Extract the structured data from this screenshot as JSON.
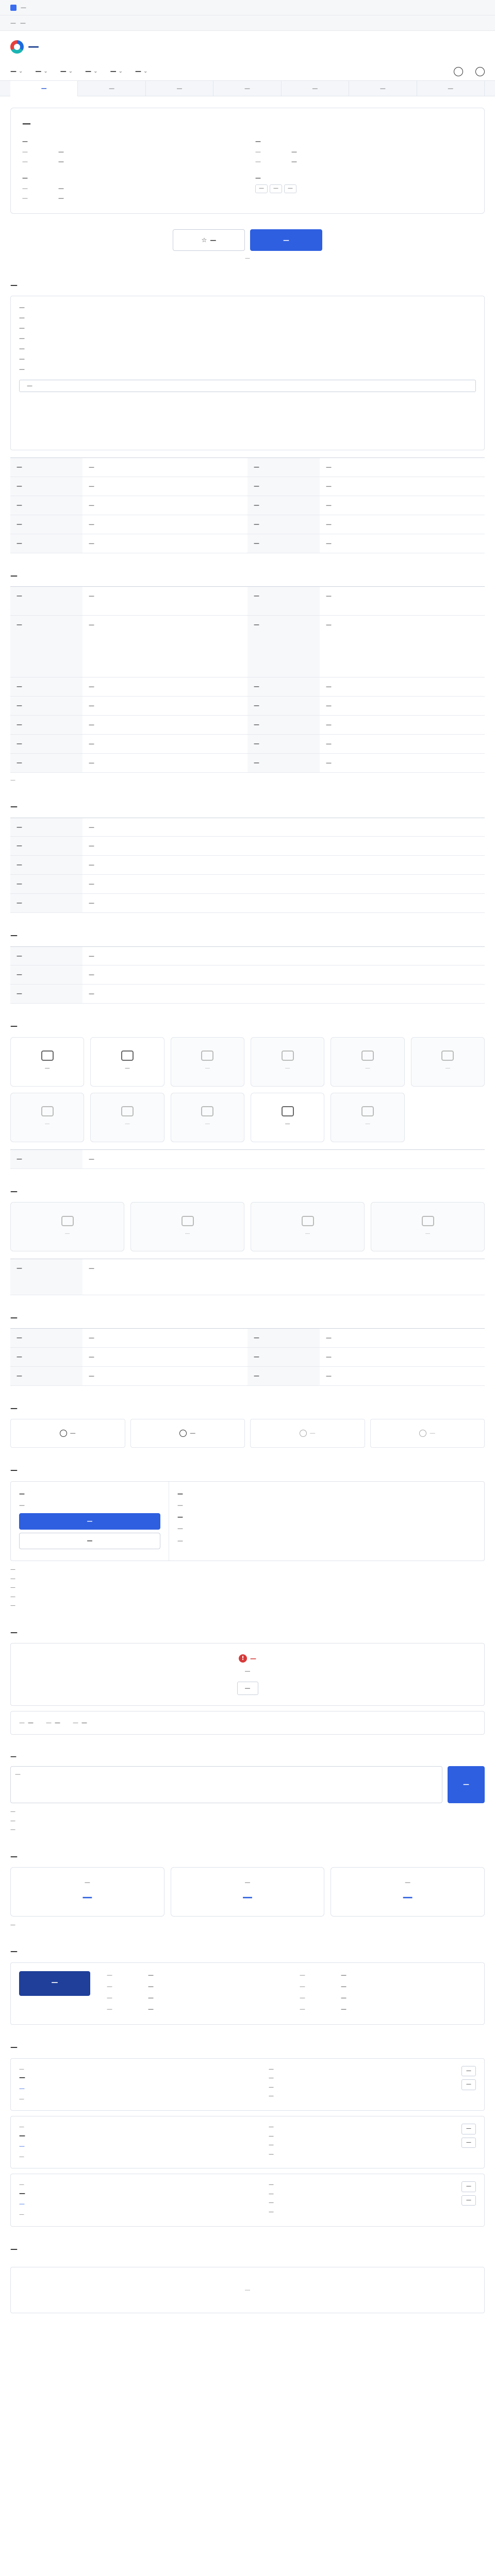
{
  "notice": {
    "text": "—",
    "links": [
      "—",
      "—"
    ]
  },
  "brand": {
    "name": "—",
    "accent": "#2e5fe0"
  },
  "nav": {
    "items": [
      "—",
      "—",
      "—",
      "—",
      "—",
      "—"
    ]
  },
  "tabs": [
    "—",
    "—",
    "—",
    "—",
    "—",
    "—",
    "—"
  ],
  "job": {
    "title": "—",
    "left": {
      "label": "—",
      "rows": [
        {
          "k": "—",
          "v": "—"
        },
        {
          "k": "—",
          "v": "—"
        }
      ]
    },
    "right": {
      "label": "—",
      "rows": [
        {
          "k": "—",
          "v": "—"
        },
        {
          "k": "—",
          "v": "—"
        }
      ]
    },
    "left2": {
      "label": "—",
      "rows": [
        {
          "k": "—",
          "v": "—"
        },
        {
          "k": "—",
          "v": "—"
        }
      ]
    },
    "right2": {
      "label": "—",
      "chips": [
        "—",
        "—",
        "—"
      ]
    }
  },
  "actions": {
    "bookmark": "—",
    "apply": "—",
    "note": "—"
  },
  "sections": {
    "recruit": {
      "title": "—",
      "lines": [
        "—",
        "—",
        "—",
        "—",
        "—",
        "—",
        "—"
      ],
      "more": "—",
      "rows": [
        {
          "k": "—",
          "v": "—",
          "k2": "—",
          "v2": "—"
        },
        {
          "k": "—",
          "v": "—",
          "k2": "—",
          "v2": "—"
        },
        {
          "k": "—",
          "v": "—",
          "k2": "—",
          "v2": "—"
        },
        {
          "k": "—",
          "v": "—",
          "k2": "—",
          "v2": "—"
        },
        {
          "k": "—",
          "v": "—",
          "k2": "—",
          "v2": "—"
        }
      ]
    },
    "conditions": {
      "title": "—",
      "rows": [
        {
          "k": "—",
          "v": "—",
          "k2": "—",
          "v2": "—"
        },
        {
          "k": "—",
          "v": "—",
          "k2": "—",
          "v2": "—"
        },
        {
          "k": "—",
          "v": "—",
          "k2": "—",
          "v2": "—"
        },
        {
          "k": "—",
          "v": "—",
          "k2": "—",
          "v2": "—"
        },
        {
          "k": "—",
          "v": "—",
          "k2": "—",
          "v2": "—"
        },
        {
          "k": "—",
          "v": "—",
          "k2": "—",
          "v2": "—"
        },
        {
          "k": "—",
          "v": "—",
          "k2": "—",
          "v2": "—"
        }
      ],
      "note": "—"
    },
    "qualify": {
      "title": "—",
      "rows": [
        {
          "k": "—",
          "v": "—"
        },
        {
          "k": "—",
          "v": "—"
        },
        {
          "k": "—",
          "v": "—"
        },
        {
          "k": "—",
          "v": "—"
        },
        {
          "k": "—",
          "v": "—"
        }
      ]
    },
    "other": {
      "title": "—",
      "rows": [
        {
          "k": "—",
          "v": "—"
        },
        {
          "k": "—",
          "v": "—"
        },
        {
          "k": "—",
          "v": "—"
        }
      ]
    },
    "welfare": {
      "title": "—",
      "items": [
        "—",
        "—",
        "—",
        "—",
        "—",
        "—",
        "—",
        "—",
        "—",
        "—",
        "—"
      ],
      "rowk": "—",
      "rowv": "—"
    },
    "disability": {
      "title": "—",
      "items": [
        "—",
        "—",
        "—",
        "—"
      ],
      "rowk": "—",
      "rowv": "—"
    },
    "workplace": {
      "title": "—",
      "rows": [
        {
          "k": "—",
          "v": "—",
          "k2": "—",
          "v2": "—"
        },
        {
          "k": "—",
          "v": "—",
          "k2": "—",
          "v2": "—"
        },
        {
          "k": "—",
          "v": "—",
          "k2": "—",
          "v2": "—"
        }
      ]
    },
    "process": {
      "title": "—",
      "steps": [
        "—",
        "—",
        "—",
        "—"
      ]
    },
    "apply": {
      "title": "—",
      "left": {
        "lab": "—",
        "v": "—",
        "b1": "—",
        "b2": "—"
      },
      "right": {
        "lab": "—",
        "v": "—",
        "lab2": "—",
        "v2": "—",
        "v3": "—"
      },
      "notes": [
        "—",
        "—",
        "—",
        "—",
        "—"
      ]
    },
    "contact": {
      "title": "—",
      "warn": "—",
      "warn_text": "—",
      "warn_btn": "—",
      "row": [
        {
          "k": "—",
          "v": "—"
        },
        {
          "k": "—",
          "v": "—"
        },
        {
          "k": "—",
          "v": "—"
        }
      ]
    },
    "inquiry": {
      "title": "—",
      "placeholder": "—",
      "send": "—",
      "bullets": [
        "—",
        "—",
        "—"
      ]
    },
    "stats": {
      "title": "—",
      "items": [
        {
          "k": "—",
          "v": "—"
        },
        {
          "k": "—",
          "v": "—"
        },
        {
          "k": "—",
          "v": "—"
        }
      ],
      "note": "—"
    },
    "company": {
      "title": "—",
      "logo": "—",
      "rows": [
        {
          "k": "—",
          "v": "—"
        },
        {
          "k": "—",
          "v": "—"
        },
        {
          "k": "—",
          "v": "—"
        },
        {
          "k": "—",
          "v": "—"
        }
      ],
      "rows2": [
        {
          "k": "—",
          "v": "—"
        },
        {
          "k": "—",
          "v": "—"
        },
        {
          "k": "—",
          "v": "—"
        },
        {
          "k": "—",
          "v": "—"
        }
      ]
    },
    "similar": {
      "title": "—",
      "jobs": [
        {
          "badge": "—",
          "t": "—",
          "co": "—",
          "sub": "—",
          "meta": [
            "—",
            "—",
            "—",
            "—"
          ],
          "cta": [
            "—",
            "—"
          ]
        },
        {
          "badge": "—",
          "t": "—",
          "co": "—",
          "sub": "—",
          "meta": [
            "—",
            "—",
            "—",
            "—"
          ],
          "cta": [
            "—",
            "—"
          ]
        },
        {
          "badge": "—",
          "t": "—",
          "co": "—",
          "sub": "—",
          "meta": [
            "—",
            "—",
            "—",
            "—"
          ],
          "cta": [
            "—",
            "—"
          ]
        }
      ]
    },
    "recent": {
      "title": "—",
      "empty": "—"
    }
  }
}
